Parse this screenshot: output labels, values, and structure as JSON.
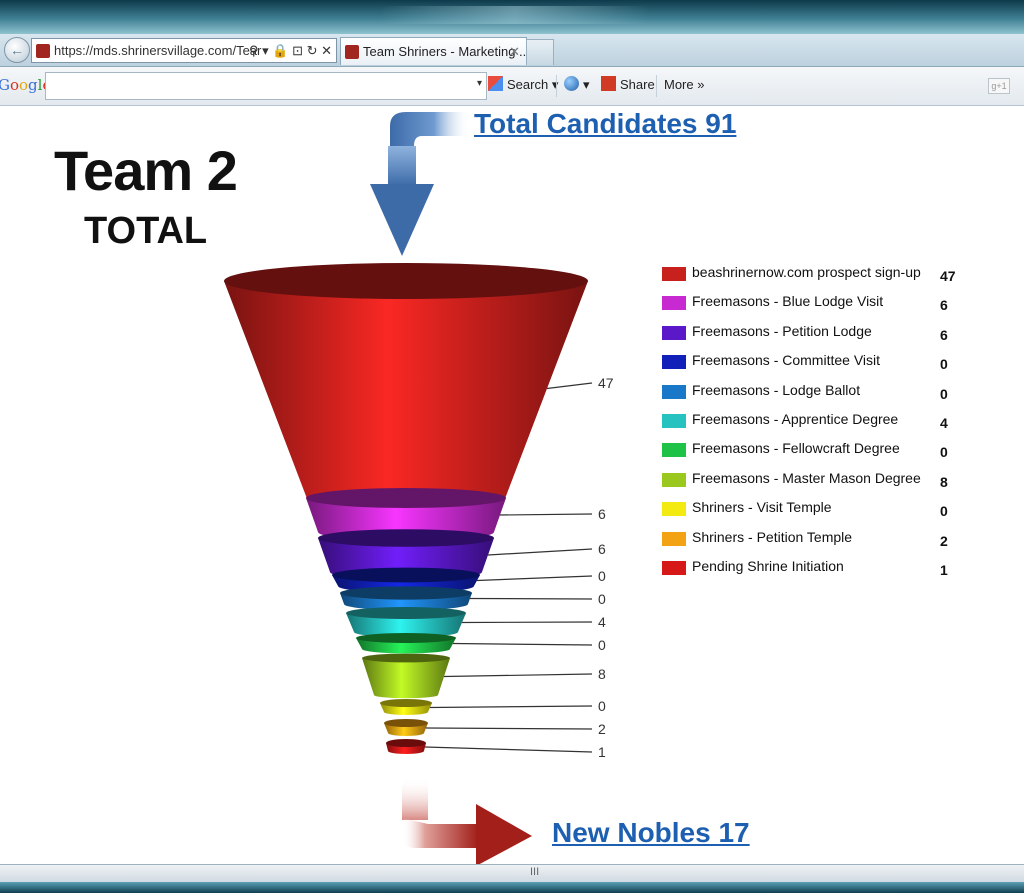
{
  "browser": {
    "back_glyph": "←",
    "url": "https://mds.shrinersvillage.com/Tear",
    "url_controls": "⚲ ▾ 🔒 ⊡ ↻ ✕",
    "tab_title": "Team Shriners - Marketing ...",
    "tab_close": "✕"
  },
  "google_toolbar": {
    "logo": "Google",
    "search_dropdown": "▾",
    "search_label": "Search",
    "share_label": "Share",
    "more_label": "More »",
    "plus_label": "g+1"
  },
  "page": {
    "team_title": "Team 2",
    "team_subtitle": "TOTAL",
    "total_link": "Total Candidates 91",
    "new_nobles_link": "New Nobles 17"
  },
  "colors": {
    "link": "#1d5fb0",
    "arrow_blue": "#3d6ba8",
    "arrow_red": "#a21f1a"
  },
  "chart_data": {
    "type": "funnel",
    "categories": [
      "beashrinernow.com prospect sign-up",
      "Freemasons - Blue Lodge Visit",
      "Freemasons - Petition Lodge",
      "Freemasons - Committee Visit",
      "Freemasons - Lodge Ballot",
      "Freemasons - Apprentice Degree",
      "Freemasons - Fellowcraft Degree",
      "Freemasons - Master Mason Degree",
      "Shriners - Visit Temple",
      "Shriners - Petition Temple",
      "Pending Shrine Initiation"
    ],
    "values": [
      47,
      6,
      6,
      0,
      0,
      4,
      0,
      8,
      0,
      2,
      1
    ],
    "colors": [
      "#c8201d",
      "#c62ad0",
      "#5a18c8",
      "#1020b8",
      "#1a78c9",
      "#25c2bf",
      "#1ec246",
      "#9bc81e",
      "#f2ea10",
      "#f2a212",
      "#d61818"
    ],
    "legend_position": "right"
  },
  "status": {
    "grip": "III"
  }
}
